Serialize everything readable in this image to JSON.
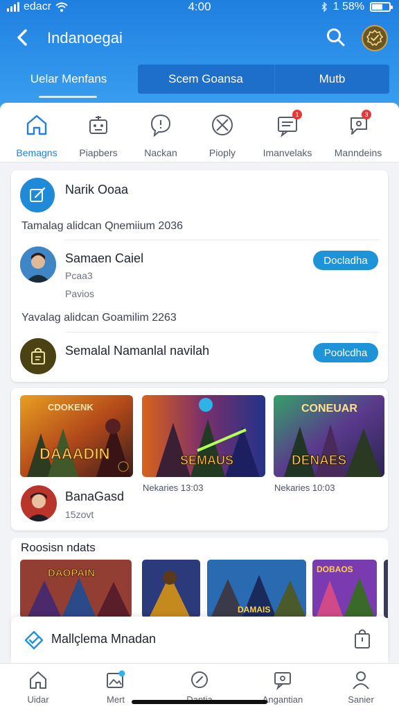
{
  "status": {
    "carrier": "edacr",
    "time": "4:00",
    "battery_text": "1 58%"
  },
  "nav": {
    "title": "Indanoegai"
  },
  "segments": [
    {
      "label": "Uelar Menfans"
    },
    {
      "label": "Scem Goansa"
    },
    {
      "label": "Mutb"
    }
  ],
  "categories": [
    {
      "label": "Bemagns",
      "icon": "home-icon",
      "active": true
    },
    {
      "label": "Piapbers",
      "icon": "robot-icon"
    },
    {
      "label": "Nackan",
      "icon": "chat-bubble-icon"
    },
    {
      "label": "Pioply",
      "icon": "swords-icon"
    },
    {
      "label": "Imanvelaks",
      "icon": "message-icon",
      "badge": "1"
    },
    {
      "label": "Manndeins",
      "icon": "comment-icon",
      "badge": "3"
    }
  ],
  "info": {
    "title": "Narik Ooaa",
    "section1": "Tamalag alidcan Qnemiium 2036",
    "entry1": {
      "name": "Samaen Caiel",
      "meta1": "Pcaa3",
      "meta2": "Pavios",
      "button": "Docladha"
    },
    "section2": "Yavalag alidcan Goamilim 2263",
    "entry2": {
      "name": "Semalal Namanlal navilah",
      "button": "Poolcdha"
    }
  },
  "games": [
    {
      "art_title": "DAAADIN",
      "art_top": "CDOKENK"
    },
    {
      "art_title": "SEMAUS",
      "art_top": "",
      "caption": "Nekaries  13:03"
    },
    {
      "art_title": "DENAES",
      "art_top": "CONEUAR",
      "caption": "Nekaries  10:03"
    }
  ],
  "games_user": {
    "name": "BanaGasd",
    "meta": "15zovt"
  },
  "recommended": {
    "title": "Roosisn ndats",
    "thumbs": [
      {
        "art_title": "DAOPAIN"
      },
      {
        "art_title": ""
      },
      {
        "art_title": "DAMAIS"
      },
      {
        "art_title": "DOBAOS"
      }
    ]
  },
  "banner": {
    "text": "Mallçlema Mnadan"
  },
  "bottom_nav": [
    {
      "label": "Uidar",
      "icon": "home-icon"
    },
    {
      "label": "Mert",
      "icon": "photo-icon"
    },
    {
      "label": "Dantia",
      "icon": "compass-icon"
    },
    {
      "label": "Angantian",
      "icon": "message-icon"
    },
    {
      "label": "Sanier",
      "icon": "user-icon"
    }
  ],
  "colors": {
    "accent": "#1f7fe0",
    "pill": "#1f93d8",
    "badge": "#e53935"
  }
}
